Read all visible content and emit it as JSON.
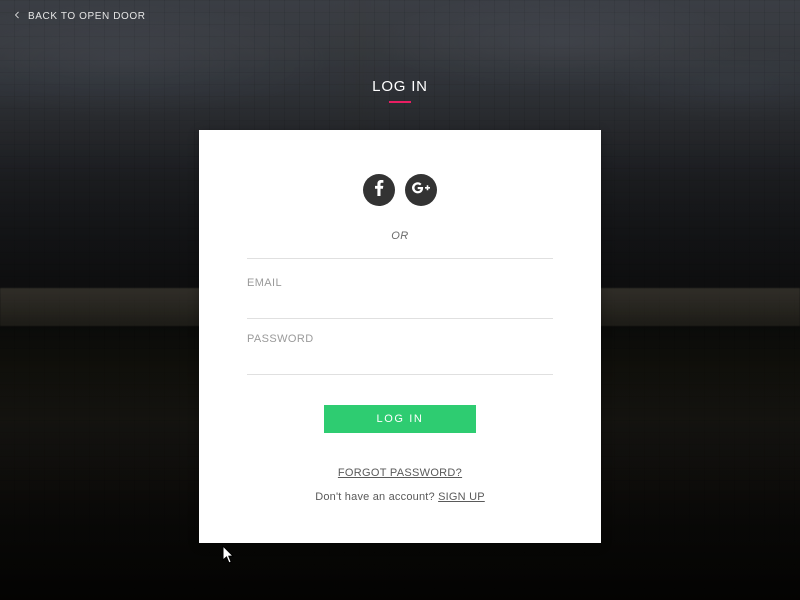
{
  "back": {
    "label": "BACK TO OPEN DOOR"
  },
  "title": "LOG IN",
  "or": "OR",
  "fields": {
    "email": {
      "label": "EMAIL",
      "value": ""
    },
    "password": {
      "label": "PASSWORD",
      "value": ""
    }
  },
  "buttons": {
    "login": "LOG IN",
    "forgot": "FORGOT PASSWORD?",
    "signup_prompt": "Don't have an account? ",
    "signup": "SIGN UP"
  },
  "icons": {
    "back": "arrow-left-icon",
    "facebook": "facebook-icon",
    "google": "google-plus-icon"
  },
  "colors": {
    "accent_pink": "#e91e63",
    "accent_green": "#2ecc71",
    "social_bg": "#333333"
  }
}
